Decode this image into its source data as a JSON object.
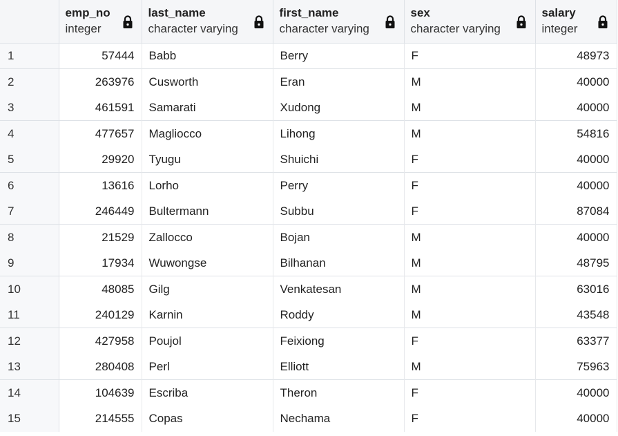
{
  "columns": [
    {
      "name": "emp_no",
      "type": "integer"
    },
    {
      "name": "last_name",
      "type": "character varying"
    },
    {
      "name": "first_name",
      "type": "character varying"
    },
    {
      "name": "sex",
      "type": "character varying"
    },
    {
      "name": "salary",
      "type": "integer"
    }
  ],
  "rows": [
    {
      "n": "1",
      "emp_no": "57444",
      "last_name": "Babb",
      "first_name": "Berry",
      "sex": "F",
      "salary": "48973"
    },
    {
      "n": "2",
      "emp_no": "263976",
      "last_name": "Cusworth",
      "first_name": "Eran",
      "sex": "M",
      "salary": "40000"
    },
    {
      "n": "3",
      "emp_no": "461591",
      "last_name": "Samarati",
      "first_name": "Xudong",
      "sex": "M",
      "salary": "40000"
    },
    {
      "n": "4",
      "emp_no": "477657",
      "last_name": "Magliocco",
      "first_name": "Lihong",
      "sex": "M",
      "salary": "54816"
    },
    {
      "n": "5",
      "emp_no": "29920",
      "last_name": "Tyugu",
      "first_name": "Shuichi",
      "sex": "F",
      "salary": "40000"
    },
    {
      "n": "6",
      "emp_no": "13616",
      "last_name": "Lorho",
      "first_name": "Perry",
      "sex": "F",
      "salary": "40000"
    },
    {
      "n": "7",
      "emp_no": "246449",
      "last_name": "Bultermann",
      "first_name": "Subbu",
      "sex": "F",
      "salary": "87084"
    },
    {
      "n": "8",
      "emp_no": "21529",
      "last_name": "Zallocco",
      "first_name": "Bojan",
      "sex": "M",
      "salary": "40000"
    },
    {
      "n": "9",
      "emp_no": "17934",
      "last_name": "Wuwongse",
      "first_name": "Bilhanan",
      "sex": "M",
      "salary": "48795"
    },
    {
      "n": "10",
      "emp_no": "48085",
      "last_name": "Gilg",
      "first_name": "Venkatesan",
      "sex": "M",
      "salary": "63016"
    },
    {
      "n": "11",
      "emp_no": "240129",
      "last_name": "Karnin",
      "first_name": "Roddy",
      "sex": "M",
      "salary": "43548"
    },
    {
      "n": "12",
      "emp_no": "427958",
      "last_name": "Poujol",
      "first_name": "Feixiong",
      "sex": "F",
      "salary": "63377"
    },
    {
      "n": "13",
      "emp_no": "280408",
      "last_name": "Perl",
      "first_name": "Elliott",
      "sex": "M",
      "salary": "75963"
    },
    {
      "n": "14",
      "emp_no": "104639",
      "last_name": "Escriba",
      "first_name": "Theron",
      "sex": "F",
      "salary": "40000"
    },
    {
      "n": "15",
      "emp_no": "214555",
      "last_name": "Copas",
      "first_name": "Nechama",
      "sex": "F",
      "salary": "40000"
    }
  ],
  "icons": {
    "column_lock": "lock-icon"
  },
  "colors": {
    "header_bg": "#f5f6f8",
    "grid_line": "#dde1e6"
  }
}
